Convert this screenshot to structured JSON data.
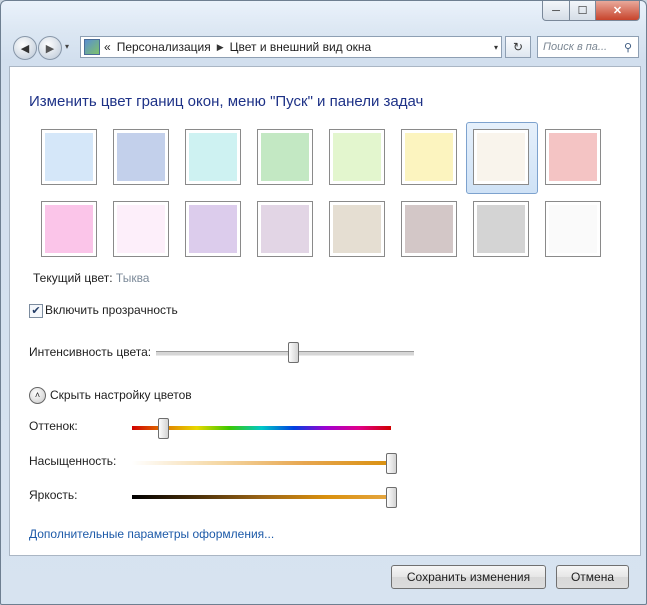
{
  "window": {
    "controls": {
      "minimize": "─",
      "maximize": "☐",
      "close": "✕"
    }
  },
  "nav": {
    "back": "◀",
    "forward": "▶",
    "history_dropdown": "▾",
    "address": {
      "prefix": "«",
      "crumbs": [
        "Персонализация",
        "Цвет и внешний вид окна"
      ],
      "separator": "▶",
      "dropdown": "▾"
    },
    "refresh": "↻",
    "search_placeholder": "Поиск в па...",
    "search_icon_glyph": "⚲"
  },
  "page": {
    "title": "Изменить цвет границ окон, меню \"Пуск\" и панели задач",
    "swatches_row1": [
      {
        "name": "sky",
        "color": "#5a9ee8"
      },
      {
        "name": "twilight",
        "color": "#1246b0"
      },
      {
        "name": "sea",
        "color": "#3fc9c9"
      },
      {
        "name": "leaf",
        "color": "#12a512"
      },
      {
        "name": "lime",
        "color": "#8ed93d"
      },
      {
        "name": "sun",
        "color": "#f2d300"
      },
      {
        "name": "pumpkin",
        "color": "#e8d4b4",
        "selected": true
      },
      {
        "name": "ruby",
        "color": "#d11616"
      }
    ],
    "swatches_row2": [
      {
        "name": "fuchsia",
        "color": "#f01aa6"
      },
      {
        "name": "blush",
        "color": "#f7c0ea"
      },
      {
        "name": "violet",
        "color": "#7636b4"
      },
      {
        "name": "lavender",
        "color": "#8b5a98"
      },
      {
        "name": "taupe",
        "color": "#977d4c"
      },
      {
        "name": "chocolate",
        "color": "#512322"
      },
      {
        "name": "slate",
        "color": "#545454"
      },
      {
        "name": "frost",
        "color": "#ececec"
      }
    ],
    "current_color_label": "Текущий цвет:",
    "current_color_value": "Тыква",
    "transparency": {
      "label": "Включить прозрачность",
      "checked": true,
      "check_glyph": "✔"
    },
    "intensity": {
      "label": "Интенсивность цвета:",
      "value_fraction": 0.53
    },
    "color_mixer": {
      "toggle_label": "Скрыть настройку цветов",
      "toggle_glyph": "˄",
      "hue_label": "Оттенок:",
      "hue_fraction": 0.12,
      "saturation_label": "Насыщенность:",
      "saturation_fraction": 1.0,
      "brightness_label": "Яркость:",
      "brightness_fraction": 1.0
    },
    "advanced_link": "Дополнительные параметры оформления..."
  },
  "buttons": {
    "save": "Сохранить изменения",
    "cancel": "Отмена"
  }
}
